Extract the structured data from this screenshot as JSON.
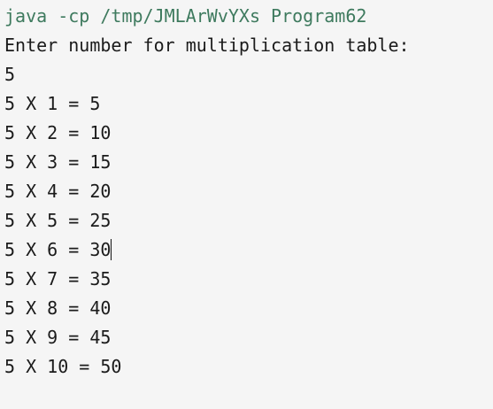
{
  "console": {
    "command": "java -cp /tmp/JMLArWvYXs Program62",
    "prompt": "Enter number for multiplication table:",
    "input_value": "5",
    "output_lines": [
      "5 X 1 = 5",
      "5 X 2 = 10",
      "5 X 3 = 15",
      "5 X 4 = 20",
      "5 X 5 = 25",
      "5 X 6 = 30",
      "5 X 7 = 35",
      "5 X 8 = 40",
      "5 X 9 = 45",
      "5 X 10 = 50"
    ]
  },
  "colors": {
    "background": "#f5f5f5",
    "command_text": "#3e7a5e",
    "output_text": "#1b1b1b"
  }
}
